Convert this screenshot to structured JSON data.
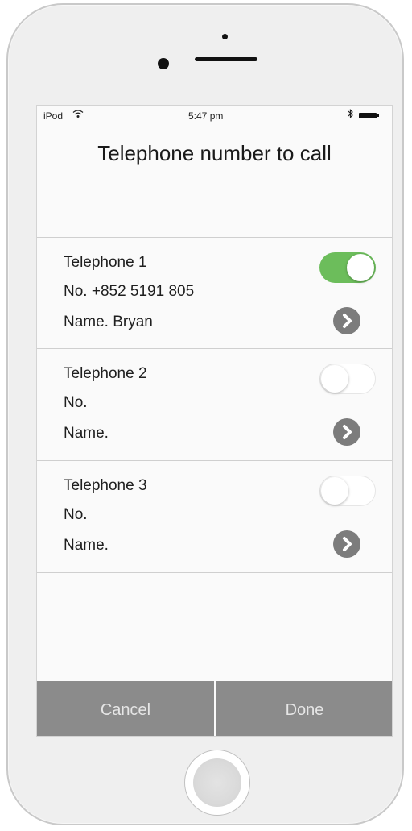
{
  "status_bar": {
    "carrier": "iPod",
    "wifi_icon": "wifi-icon",
    "time": "5:47 pm",
    "bluetooth_icon": "bluetooth-icon",
    "battery_icon": "battery-icon"
  },
  "title": "Telephone number to call",
  "phones": [
    {
      "heading": "Telephone 1",
      "number": "No. +852 5191 805",
      "name": "Name. Bryan",
      "enabled": true
    },
    {
      "heading": "Telephone 2",
      "number": "No.",
      "name": "Name.",
      "enabled": false
    },
    {
      "heading": "Telephone 3",
      "number": "No.",
      "name": "Name.",
      "enabled": false
    }
  ],
  "buttons": {
    "cancel": "Cancel",
    "done": "Done"
  },
  "colors": {
    "toggle_on": "#6cbd5b",
    "button_bg": "#8b8b8b",
    "chevron_bg": "#7c7c7c"
  }
}
